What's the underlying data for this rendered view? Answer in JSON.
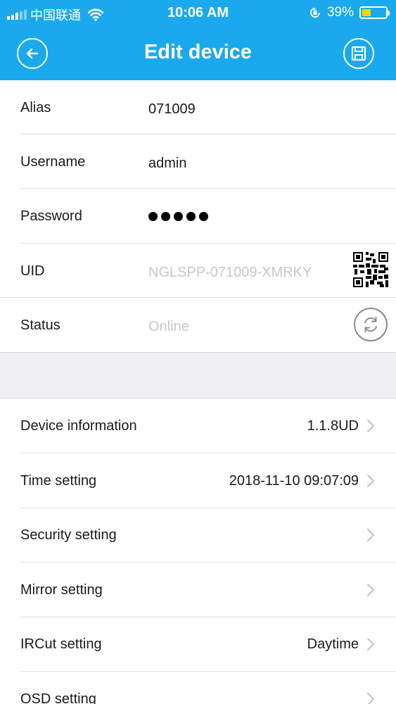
{
  "status_bar": {
    "carrier": "中国联通",
    "time": "10:06 AM",
    "battery_percent": "39%",
    "battery_level": 0.39,
    "signal_icon": "signal-icon",
    "wifi_icon": "wifi-icon",
    "lock_icon": "orientation-lock-icon"
  },
  "nav": {
    "title": "Edit device",
    "back_icon": "back-arrow-icon",
    "save_icon": "save-icon",
    "color": "#1aa9ec"
  },
  "device": {
    "alias_label": "Alias",
    "alias_value": "071009",
    "username_label": "Username",
    "username_value": "admin",
    "password_label": "Password",
    "password_length": 5,
    "uid_label": "UID",
    "uid_value": "NGLSPP-071009-XMRKY",
    "status_label": "Status",
    "status_value": "Online"
  },
  "settings": [
    {
      "label": "Device information",
      "value": "1.1.8UD"
    },
    {
      "label": "Time setting",
      "value": "2018-11-10 09:07:09"
    },
    {
      "label": "Security setting",
      "value": ""
    },
    {
      "label": "Mirror setting",
      "value": ""
    },
    {
      "label": "IRCut setting",
      "value": "Daytime"
    },
    {
      "label": "OSD setting",
      "value": ""
    }
  ]
}
